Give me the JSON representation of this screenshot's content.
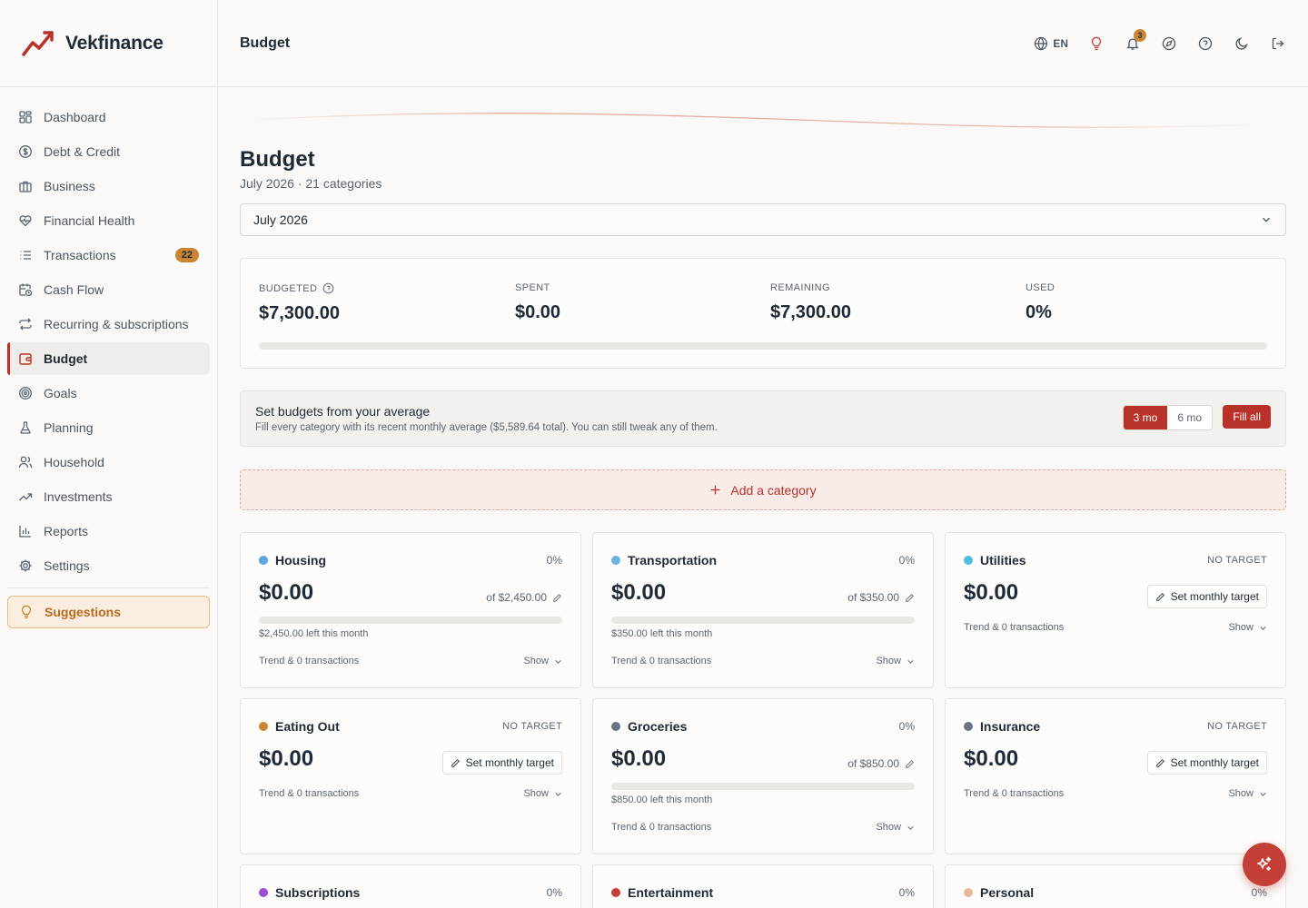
{
  "brand": {
    "name": "Vekfinance",
    "accent": "#b8322a"
  },
  "sidebar": {
    "items": [
      {
        "label": "Dashboard",
        "icon": "grid-icon"
      },
      {
        "label": "Debt & Credit",
        "icon": "dollar-circle-icon"
      },
      {
        "label": "Business",
        "icon": "briefcase-icon"
      },
      {
        "label": "Financial Health",
        "icon": "heart-pulse-icon"
      },
      {
        "label": "Transactions",
        "icon": "list-icon",
        "badge": "22"
      },
      {
        "label": "Cash Flow",
        "icon": "calendar-clock-icon"
      },
      {
        "label": "Recurring & subscriptions",
        "icon": "repeat-icon"
      },
      {
        "label": "Budget",
        "icon": "wallet-icon",
        "active": true
      },
      {
        "label": "Goals",
        "icon": "target-icon"
      },
      {
        "label": "Planning",
        "icon": "flask-icon"
      },
      {
        "label": "Household",
        "icon": "users-icon"
      },
      {
        "label": "Investments",
        "icon": "trending-up-icon"
      },
      {
        "label": "Reports",
        "icon": "bar-chart-icon"
      },
      {
        "label": "Settings",
        "icon": "gear-icon"
      }
    ],
    "suggestions_label": "Suggestions"
  },
  "topbar": {
    "title": "Budget",
    "language": "EN",
    "notification_count": "3"
  },
  "page": {
    "title": "Budget",
    "subtitle": "July 2026 · 21 categories",
    "month_select": "July 2026"
  },
  "summary": {
    "budgeted_label": "BUDGETED",
    "budgeted_value": "$7,300.00",
    "spent_label": "SPENT",
    "spent_value": "$0.00",
    "remaining_label": "REMAINING",
    "remaining_value": "$7,300.00",
    "used_label": "USED",
    "used_value": "0%",
    "used_fraction": 0
  },
  "average": {
    "title": "Set budgets from your average",
    "description": "Fill every category with its recent monthly average ($5,589.64 total). You can still tweak any of them.",
    "option_3": "3 mo",
    "option_6": "6 mo",
    "fill_label": "Fill all"
  },
  "add_category_label": "Add a category",
  "categories": [
    {
      "name": "Housing",
      "color": "#5aa6e0",
      "pct": "0%",
      "amount": "$0.00",
      "target": "of $2,450.00",
      "left": "$2,450.00 left this month",
      "trend": "Trend & 0 transactions",
      "show": "Show"
    },
    {
      "name": "Transportation",
      "color": "#6ab3e0",
      "pct": "0%",
      "amount": "$0.00",
      "target": "of $350.00",
      "left": "$350.00 left this month",
      "trend": "Trend & 0 transactions",
      "show": "Show"
    },
    {
      "name": "Utilities",
      "color": "#4dbde0",
      "notarget": "NO TARGET",
      "amount": "$0.00",
      "set_label": "Set monthly target",
      "trend": "Trend & 0 transactions",
      "show": "Show"
    },
    {
      "name": "Eating Out",
      "color": "#c9852f",
      "notarget": "NO TARGET",
      "amount": "$0.00",
      "set_label": "Set monthly target",
      "trend": "Trend & 0 transactions",
      "show": "Show"
    },
    {
      "name": "Groceries",
      "color": "#6b7280",
      "pct": "0%",
      "amount": "$0.00",
      "target": "of $850.00",
      "left": "$850.00 left this month",
      "trend": "Trend & 0 transactions",
      "show": "Show"
    },
    {
      "name": "Insurance",
      "color": "#6b7280",
      "notarget": "NO TARGET",
      "amount": "$0.00",
      "set_label": "Set monthly target",
      "trend": "Trend & 0 transactions",
      "show": "Show"
    },
    {
      "name": "Subscriptions",
      "color": "#9b4fd6",
      "pct": "0%"
    },
    {
      "name": "Entertainment",
      "color": "#c43f36",
      "pct": "0%"
    },
    {
      "name": "Personal",
      "color": "#e6b89a",
      "pct": "0%"
    }
  ]
}
